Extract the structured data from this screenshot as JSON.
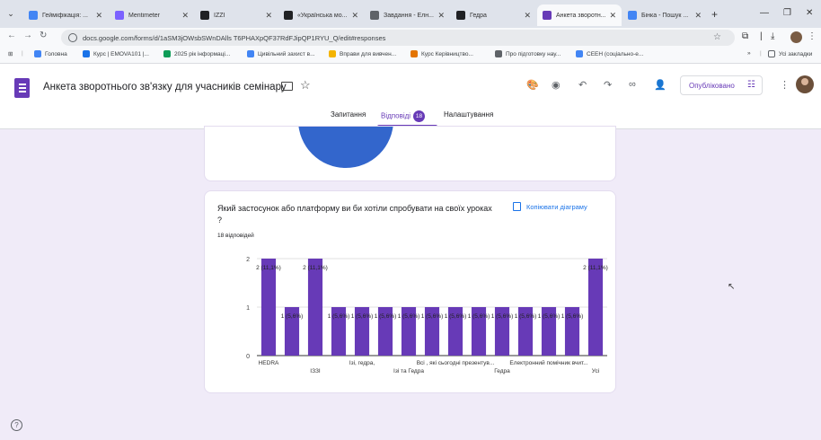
{
  "browser": {
    "tabs": [
      {
        "title": "Гейміфікація: ...",
        "color": "#4285f4",
        "active": false
      },
      {
        "title": "Mentimeter",
        "color": "#7b61ff",
        "active": false
      },
      {
        "title": "IZZI",
        "color": "#202124",
        "active": false
      },
      {
        "title": "«Українська мо...",
        "color": "#202124",
        "active": false
      },
      {
        "title": "Завдання - Елн...",
        "color": "#5f6368",
        "active": false
      },
      {
        "title": "Гедра",
        "color": "#202124",
        "active": false
      },
      {
        "title": "Анкета зворотн...",
        "color": "#673ab7",
        "active": true
      },
      {
        "title": "Бінка - Пошук ...",
        "color": "#4285f4",
        "active": false
      }
    ],
    "url": "docs.google.com/forms/d/1aSM3jOWsbSWnDAlls T6PHAXpQF37RdFJipQP1RYU_Q/edit#responses",
    "bookmarks": [
      {
        "label": "Головна",
        "color": "#4285f4"
      },
      {
        "label": "Курс | EMOVA101 |...",
        "color": "#1a73e8"
      },
      {
        "label": "2025 рік інформаці...",
        "color": "#0f9d58"
      },
      {
        "label": "Цивільний захист в...",
        "color": "#4285f4"
      },
      {
        "label": "Вправи для вивчен...",
        "color": "#f4b400"
      },
      {
        "label": "Курс Керівництво...",
        "color": "#e37400"
      },
      {
        "label": "Про підготовку нау...",
        "color": "#5f6368"
      },
      {
        "label": "СЕЕН (соціально-е...",
        "color": "#4285f4"
      }
    ],
    "bookmarks_more": "»",
    "all_bookmarks": "Усі закладки"
  },
  "form": {
    "title": "Анкета зворотнього зв'язку для учасників семінару",
    "publish_label": "Опубліковано",
    "tabs": {
      "questions": "Запитання",
      "responses": "Відповіді",
      "responses_count": "18",
      "settings": "Налаштування"
    }
  },
  "question": {
    "title": "Який застосунок або платформу ви би хотіли спробувати на своїх уроках ?",
    "responses_label": "18 відповідей",
    "copy_label": "Копіювати діаграму"
  },
  "chart_data": {
    "type": "bar",
    "color": "#673ab7",
    "ylim": [
      0,
      2
    ],
    "yticks": [
      0,
      1,
      2
    ],
    "values": [
      2,
      1,
      2,
      1,
      1,
      1,
      1,
      1,
      1,
      1,
      1,
      1,
      1,
      1,
      2
    ],
    "labels": [
      "2 (11,1%)",
      "1 (5,6%)",
      "2 (11,1%)",
      "1 (5,6%)",
      "1 (5,6%)",
      "1 (5,6%)",
      "1 (5,6%)",
      "1 (5,6%)",
      "1 (5,6%)",
      "1 (5,6%)",
      "1 (5,6%)",
      "1 (5,6%)",
      "1 (5,6%)",
      "1 (5,6%)",
      "2 (11,1%)"
    ],
    "xtick_labels": [
      {
        "index": 0,
        "text": "HEDRA",
        "row": 1
      },
      {
        "index": 2,
        "text": "IЗЗІ",
        "row": 2
      },
      {
        "index": 4,
        "text": "Ізі, гедра,",
        "row": 1
      },
      {
        "index": 6,
        "text": "Ізі та Гедра",
        "row": 2
      },
      {
        "index": 8,
        "text": "Всі , які сьогодні презентув...",
        "row": 1
      },
      {
        "index": 10,
        "text": "Гедра",
        "row": 2
      },
      {
        "index": 12,
        "text": "Електронний помічник вчит...",
        "row": 1
      },
      {
        "index": 14,
        "text": "Усі",
        "row": 2
      }
    ]
  }
}
